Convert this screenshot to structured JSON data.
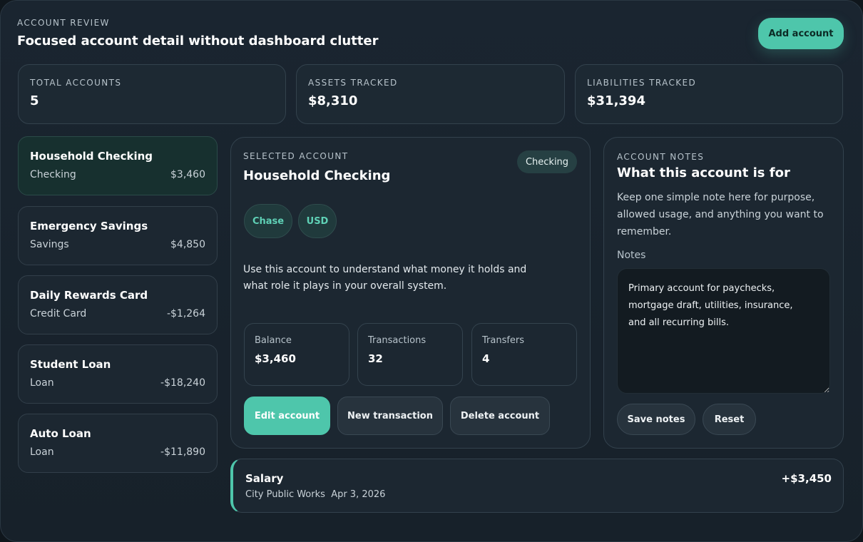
{
  "header": {
    "eyebrow": "ACCOUNT REVIEW",
    "title": "Focused account detail without dashboard clutter",
    "add_button": "Add account"
  },
  "stats": [
    {
      "label": "TOTAL ACCOUNTS",
      "value": "5"
    },
    {
      "label": "ASSETS TRACKED",
      "value": "$8,310"
    },
    {
      "label": "LIABILITIES TRACKED",
      "value": "$31,394"
    }
  ],
  "accounts": [
    {
      "name": "Household Checking",
      "type": "Checking",
      "balance": "$3,460"
    },
    {
      "name": "Emergency Savings",
      "type": "Savings",
      "balance": "$4,850"
    },
    {
      "name": "Daily Rewards Card",
      "type": "Credit Card",
      "balance": "-$1,264"
    },
    {
      "name": "Student Loan",
      "type": "Loan",
      "balance": "-$18,240"
    },
    {
      "name": "Auto Loan",
      "type": "Loan",
      "balance": "-$11,890"
    }
  ],
  "selected": {
    "eyebrow": "SELECTED ACCOUNT",
    "name": "Household Checking",
    "badge": "Checking",
    "chips": [
      "Chase",
      "USD"
    ],
    "description_line1": "Use this account to understand what money it holds and",
    "description_line2": "what role it plays in your overall system.",
    "metrics": [
      {
        "label": "Balance",
        "value": "$3,460"
      },
      {
        "label": "Transactions",
        "value": "32"
      },
      {
        "label": "Transfers",
        "value": "4"
      }
    ],
    "buttons": {
      "edit": "Edit account",
      "new_transaction": "New transaction",
      "delete": "Delete account"
    }
  },
  "notes": {
    "eyebrow": "ACCOUNT NOTES",
    "title": "What this account is for",
    "desc_line1": "Keep one simple note here for purpose,",
    "desc_line2": "allowed usage, and anything you want to",
    "desc_line3": "remember.",
    "field_label": "Notes",
    "value": "Primary account for paychecks,\nmortgage draft, utilities, insurance,\nand all recurring bills.",
    "save_button": "Save notes",
    "reset_button": "Reset"
  },
  "transaction": {
    "title": "Salary",
    "payee": "City Public Works",
    "date": "Apr 3, 2026",
    "amount": "+$3,450"
  },
  "colors": {
    "accent": "#4ec6ab",
    "background": "#17212a",
    "card": "#1c2731"
  }
}
